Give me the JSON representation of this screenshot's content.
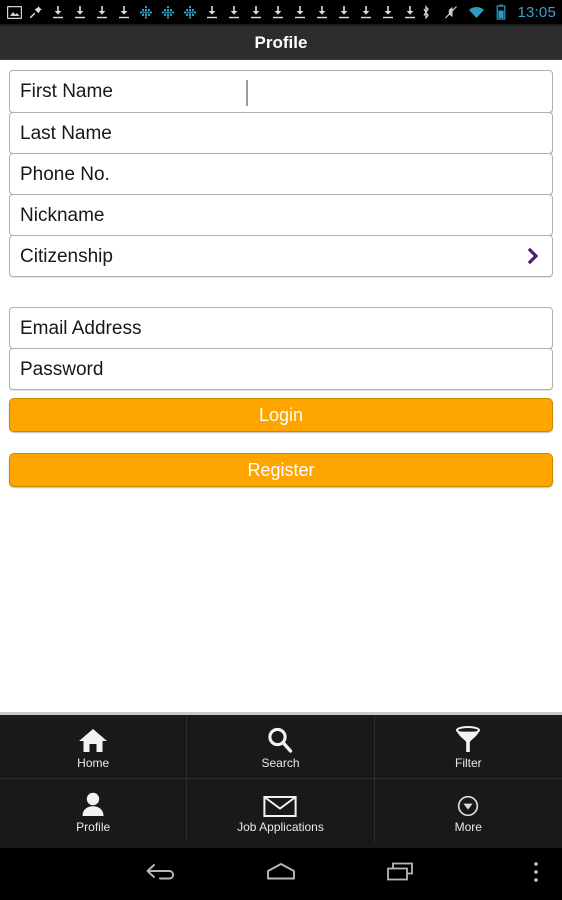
{
  "statusbar": {
    "time": "13:05",
    "left_icons": [
      "image-icon",
      "pushpin-icon",
      "download-icon",
      "download-icon",
      "download-icon",
      "download-icon",
      "sync-icon",
      "sync-icon",
      "sync-icon",
      "download-icon",
      "download-icon",
      "download-icon",
      "download-icon",
      "download-icon",
      "download-icon",
      "download-icon",
      "download-icon",
      "download-icon"
    ],
    "right_icons": [
      "bluetooth-icon",
      "mute-icon",
      "wifi-icon",
      "battery-icon"
    ],
    "clock_color": "#3aa3d0"
  },
  "titlebar": {
    "title": "Profile",
    "background": "#2c2c2c"
  },
  "form": {
    "profile_fields": [
      {
        "label": "First Name",
        "value": "",
        "focused": true
      },
      {
        "label": "Last Name",
        "value": "",
        "focused": false
      },
      {
        "label": "Phone No.",
        "value": "",
        "focused": false
      },
      {
        "label": "Nickname",
        "value": "",
        "focused": false
      },
      {
        "label": "Citizenship",
        "value": "",
        "focused": false,
        "chevron": "chevron-right-icon"
      }
    ],
    "account_fields": [
      {
        "label": "Email Address",
        "value": ""
      },
      {
        "label": "Password",
        "value": ""
      }
    ],
    "buttons": [
      {
        "label": "Login"
      },
      {
        "label": "Register"
      }
    ],
    "accent_color": "#ffa500",
    "chevron_color": "#4b2070"
  },
  "tabbar": {
    "rows": [
      [
        {
          "label": "Home",
          "icon": "home-icon"
        },
        {
          "label": "Search",
          "icon": "search-icon"
        },
        {
          "label": "Filter",
          "icon": "filter-icon"
        }
      ],
      [
        {
          "label": "Profile",
          "icon": "person-icon"
        },
        {
          "label": "Job Applications",
          "icon": "envelope-icon"
        },
        {
          "label": "More",
          "icon": "chevron-down-circle-icon"
        }
      ]
    ],
    "background": "#191919"
  },
  "navbar": {
    "buttons": [
      {
        "name": "back",
        "icon": "back-arrow-icon"
      },
      {
        "name": "home",
        "icon": "home-outline-icon"
      },
      {
        "name": "recents",
        "icon": "recents-icon"
      },
      {
        "name": "menu",
        "icon": "overflow-menu-icon"
      }
    ]
  }
}
